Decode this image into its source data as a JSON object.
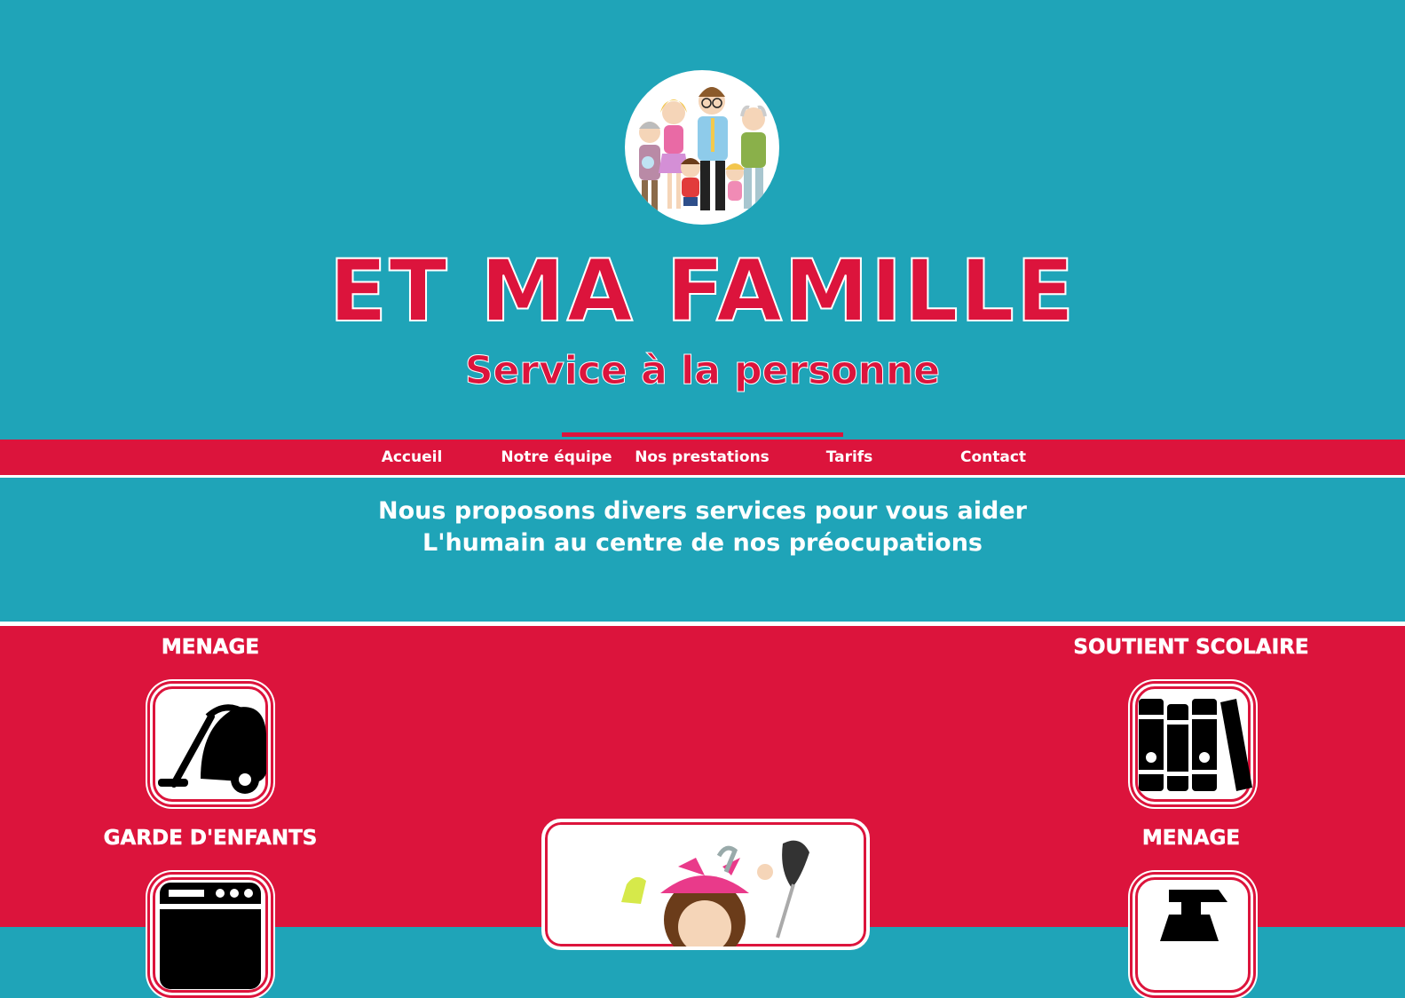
{
  "header": {
    "title": "ET MA FAMILLE",
    "subtitle": "Service à la personne",
    "logo_icon": "family-illustration-icon"
  },
  "nav": {
    "items": [
      {
        "label": "Accueil"
      },
      {
        "label": "Notre équipe"
      },
      {
        "label": "Nos prestations"
      },
      {
        "label": "Tarifs"
      },
      {
        "label": "Contact"
      }
    ],
    "active": "Nos prestations"
  },
  "intro": {
    "line1": "Nous proposons divers services pour vous aider",
    "line2": "L'humain au centre de nos préocupations"
  },
  "services": {
    "items": [
      {
        "title": "MENAGE",
        "icon": "vacuum-cleaner-icon"
      },
      {
        "title": "SOUTIENT SCOLAIRE",
        "icon": "books-icon"
      },
      {
        "title": "GARDE D'ENFANTS",
        "icon": "washing-machine-icon"
      },
      {
        "title": "MENAGE",
        "icon": "spray-bottle-icon"
      }
    ],
    "feature_icon": "cleaning-lady-illustration-icon"
  },
  "colors": {
    "teal": "#1fa4b8",
    "crimson": "#dc143c",
    "white": "#ffffff"
  }
}
